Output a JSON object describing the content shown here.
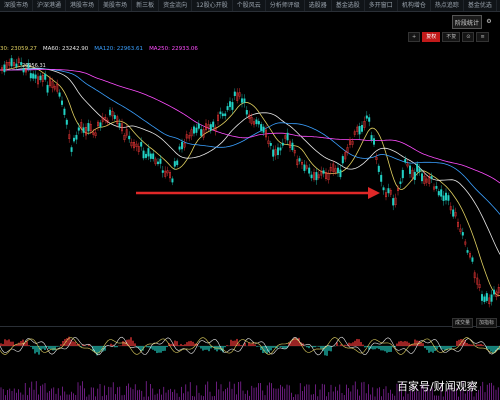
{
  "top_tabs": [
    "深股市场",
    "沪深港通",
    "港股市场",
    "美股市场",
    "新三板",
    "资金流向",
    "12股心开股",
    "个股风云",
    "分析师评级",
    "选股器",
    "基金选股",
    "多开窗口",
    "机构增仓",
    "热点追踪",
    "基金优选"
  ],
  "toolbar": {
    "stat_button": "阶段统计",
    "settings_icon": "⚙"
  },
  "controls": [
    "+",
    "复权",
    "不复",
    "⊙",
    "≡"
  ],
  "ma_legend": [
    {
      "label": "30",
      "value": "23059.27",
      "color": "#e0d060"
    },
    {
      "label": "MA60",
      "value": "23242.90",
      "color": "#e8e8e8"
    },
    {
      "label": "MA120",
      "value": "22963.61",
      "color": "#3aa0ff"
    },
    {
      "label": "MA250",
      "value": "22933.06",
      "color": "#ff4cff"
    }
  ],
  "price_marker": "26956.31",
  "indicator_tabs": [
    "成交量",
    "加指标"
  ],
  "watermark": "百家号/财闻观察",
  "colors": {
    "up": "#ff3b3b",
    "down": "#22d3c5",
    "arrow": "#e02828"
  }
}
